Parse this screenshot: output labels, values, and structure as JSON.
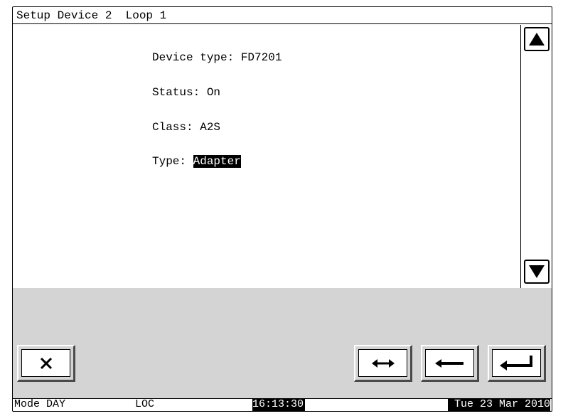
{
  "title": "Setup Device 2  Loop 1",
  "fields": {
    "device_type_label": "Device type: ",
    "device_type_value": "FD7201",
    "status_label": "Status: ",
    "status_value": "On",
    "class_label": "Class: ",
    "class_value": "A2S",
    "type_label": "Type: ",
    "type_value": "Adapter"
  },
  "icons": {
    "scroll_up": "triangle-up-icon",
    "scroll_down": "triangle-down-icon",
    "cancel": "close-icon",
    "toggle": "double-arrow-icon",
    "back": "arrow-left-icon",
    "enter": "enter-icon"
  },
  "status_bar": {
    "mode": "Mode DAY",
    "access": "LOC",
    "time": "16:13:30",
    "date": "Tue 23 Mar 2010"
  },
  "colors": {
    "background": "#ffffff",
    "panel": "#d4d4d4",
    "highlight": "#000000"
  }
}
